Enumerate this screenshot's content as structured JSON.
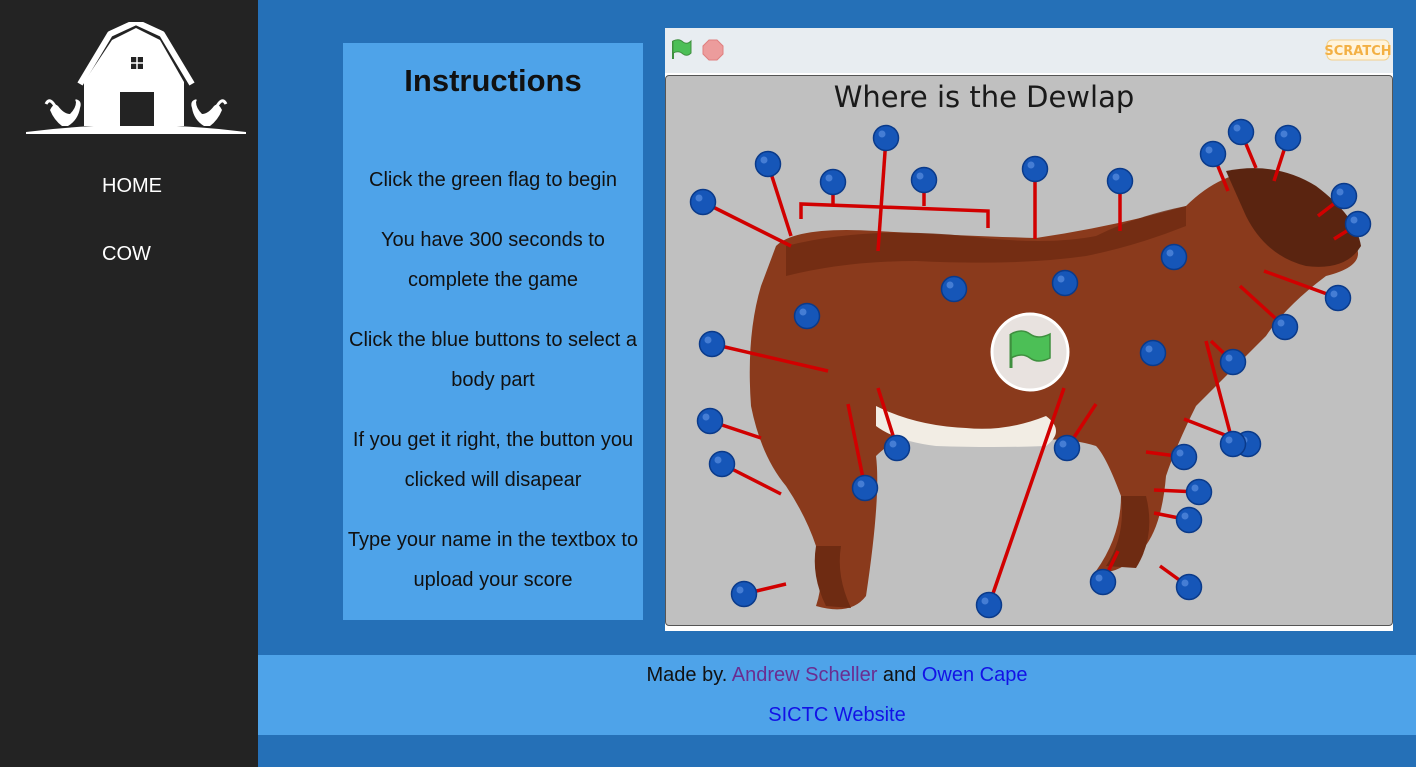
{
  "nav": {
    "items": [
      {
        "label": "HOME"
      },
      {
        "label": "COW"
      }
    ]
  },
  "instructions": {
    "title": "Instructions",
    "steps": [
      "Click the green flag to begin",
      "You have 300 seconds to complete the game",
      "Click the blue buttons to select a body part",
      "If you get it right, the button you clicked will disapear",
      "Type your name in the textbox to upload your score"
    ]
  },
  "game": {
    "question": "Where is the Dewlap",
    "logo_text": "SCRATCH",
    "colors": {
      "button_blue": "#1656b8",
      "pointer_red": "#d10000",
      "flag_green": "#4cbf56",
      "stop_red": "#ec9c9c"
    }
  },
  "footer": {
    "made_by": "Made by.",
    "author1": "Andrew Scheller",
    "and": "and",
    "author2": "Owen Cape",
    "site_link": "SICTC Website"
  }
}
